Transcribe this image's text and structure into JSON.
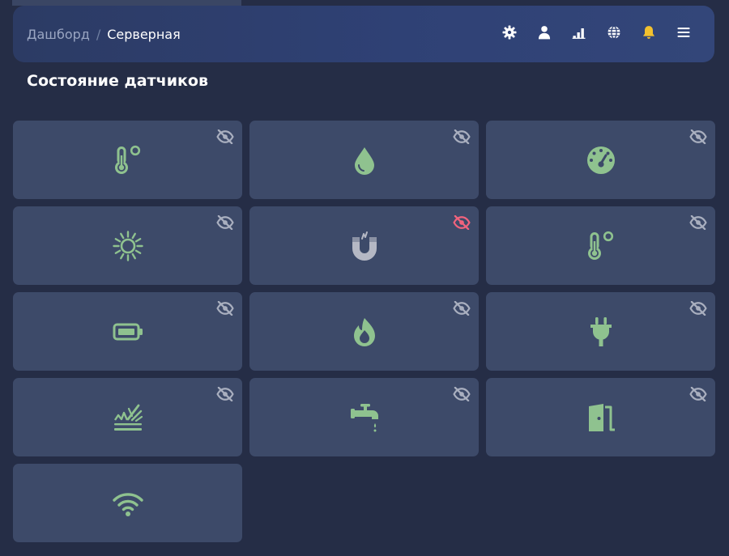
{
  "header": {
    "breadcrumb": {
      "parent": "Дашборд",
      "separator": "/",
      "current": "Серверная"
    },
    "icons": [
      {
        "name": "gear-icon",
        "color": "#ffffff"
      },
      {
        "name": "user-icon",
        "color": "#ffffff"
      },
      {
        "name": "signal-bars-icon",
        "color": "#ffffff"
      },
      {
        "name": "globe-icon",
        "color": "#ffffff"
      },
      {
        "name": "bell-icon",
        "color": "#f2c12e"
      },
      {
        "name": "menu-icon",
        "color": "#ffffff"
      }
    ]
  },
  "page": {
    "title": "Состояние датчиков"
  },
  "colors": {
    "accent_green": "#8fc28f",
    "inactive_gray": "#b5b8c4",
    "hidden_eye": "#a9afbf",
    "alert_red": "#f0637d"
  },
  "sensors": [
    {
      "icon": "thermometer-icon",
      "state": "ok",
      "visibility_icon": "eye-slash-icon",
      "visibility_alert": false
    },
    {
      "icon": "water-drop-icon",
      "state": "ok",
      "visibility_icon": "eye-slash-icon",
      "visibility_alert": false
    },
    {
      "icon": "gauge-icon",
      "state": "ok",
      "visibility_icon": "eye-slash-icon",
      "visibility_alert": false
    },
    {
      "icon": "sun-icon",
      "state": "ok",
      "visibility_icon": "eye-slash-icon",
      "visibility_alert": false
    },
    {
      "icon": "magnet-icon",
      "state": "inactive",
      "visibility_icon": "eye-slash-icon",
      "visibility_alert": true
    },
    {
      "icon": "thermometer-icon",
      "state": "ok",
      "visibility_icon": "eye-slash-icon",
      "visibility_alert": false
    },
    {
      "icon": "battery-icon",
      "state": "ok",
      "visibility_icon": "eye-slash-icon",
      "visibility_alert": false
    },
    {
      "icon": "flame-icon",
      "state": "ok",
      "visibility_icon": "eye-slash-icon",
      "visibility_alert": false
    },
    {
      "icon": "power-plug-icon",
      "state": "ok",
      "visibility_icon": "eye-slash-icon",
      "visibility_alert": false
    },
    {
      "icon": "vibration-icon",
      "state": "ok",
      "visibility_icon": "eye-slash-icon",
      "visibility_alert": false
    },
    {
      "icon": "water-tap-icon",
      "state": "ok",
      "visibility_icon": "eye-slash-icon",
      "visibility_alert": false
    },
    {
      "icon": "door-icon",
      "state": "ok",
      "visibility_icon": "eye-slash-icon",
      "visibility_alert": false
    },
    {
      "icon": "wifi-icon",
      "state": "ok",
      "visibility_icon": null,
      "visibility_alert": false
    }
  ]
}
